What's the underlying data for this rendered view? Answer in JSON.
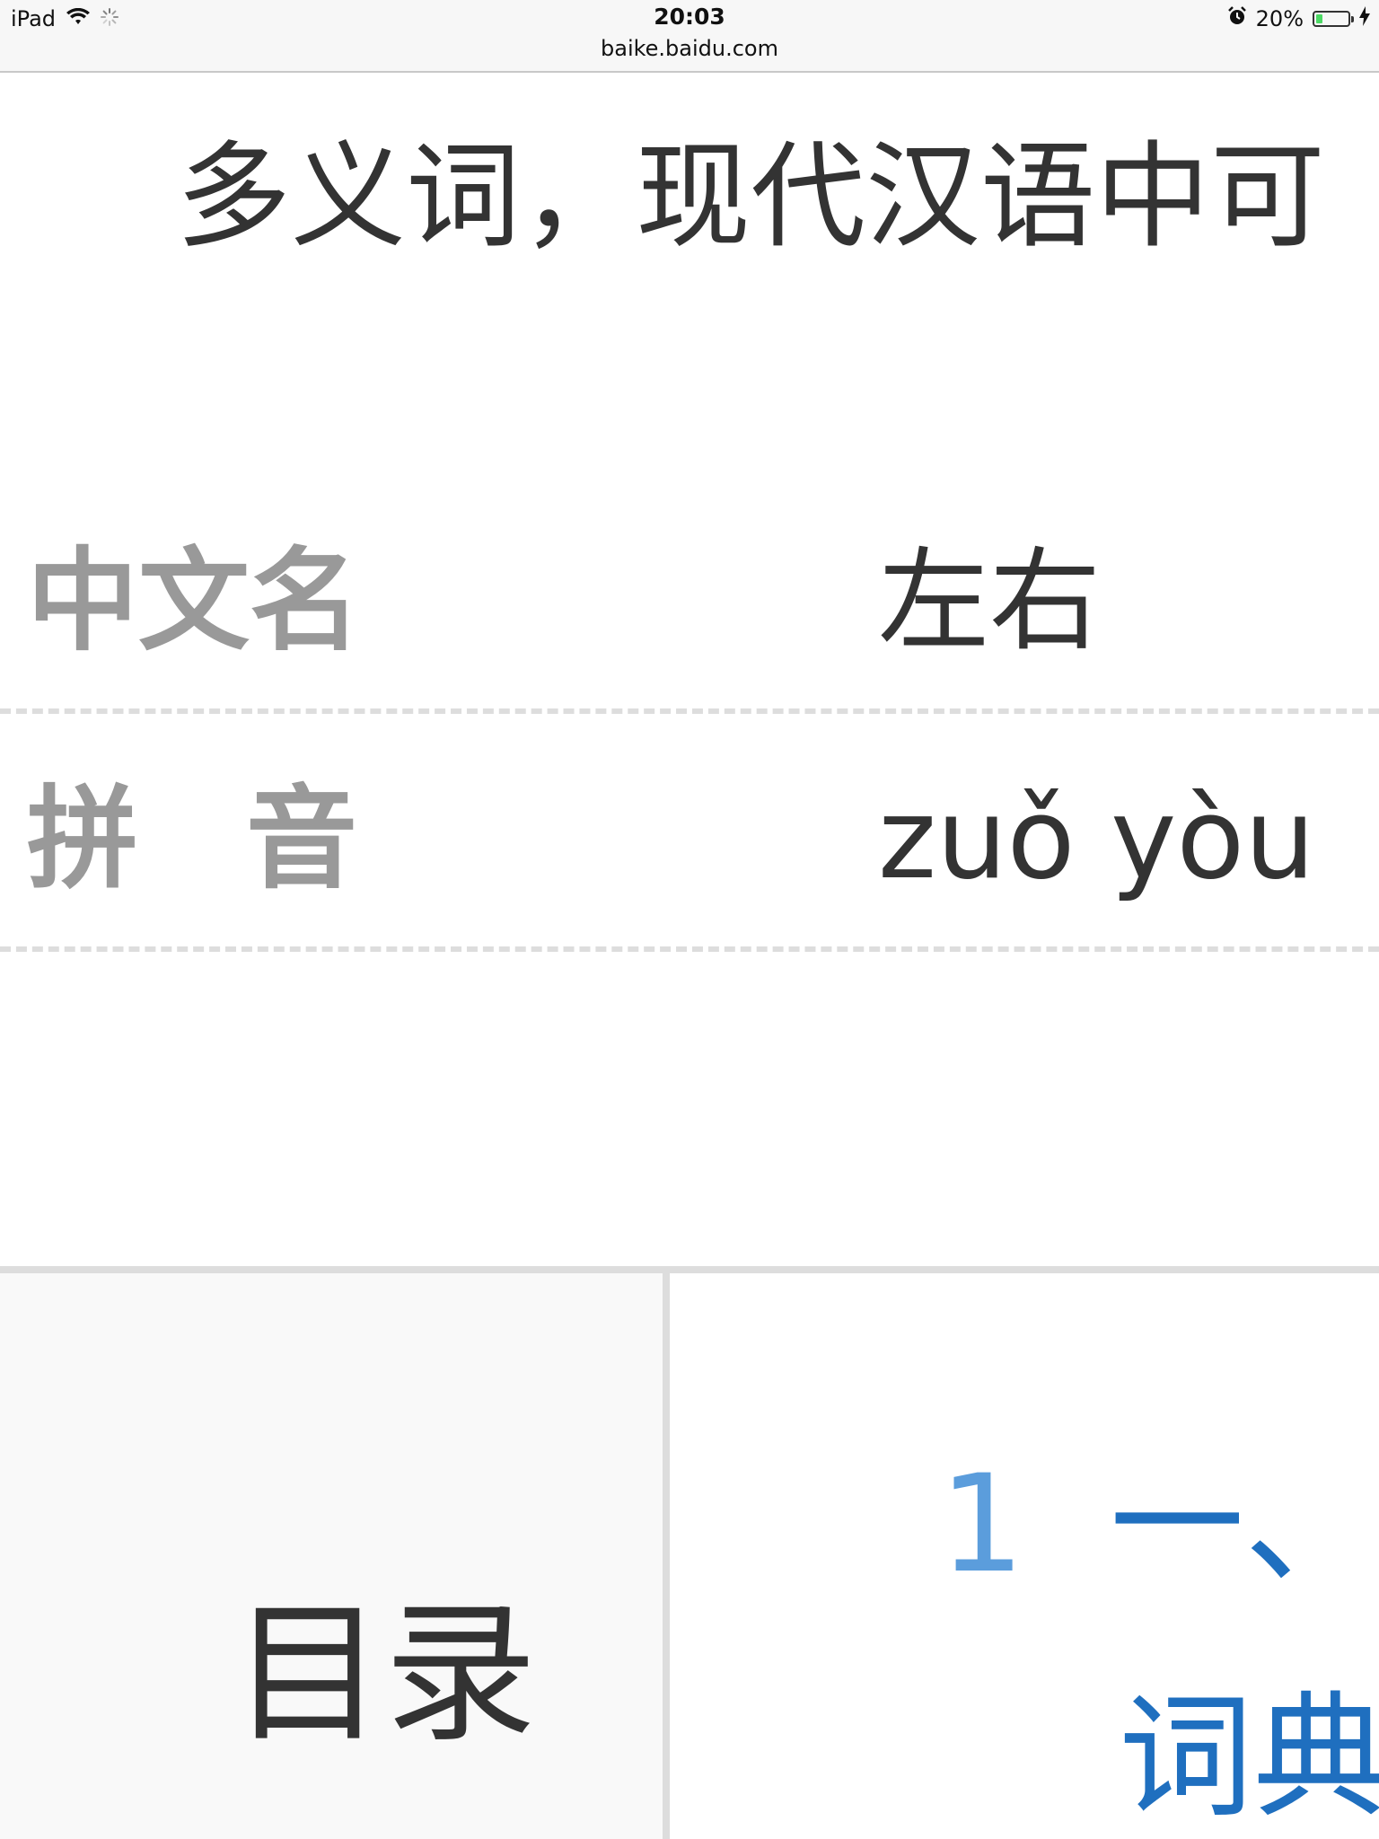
{
  "status_bar": {
    "device": "iPad",
    "time": "20:03",
    "battery_text": "20%",
    "battery_level": 0.2,
    "url": "baike.baidu.com"
  },
  "article": {
    "summary": "多义词，现代汉语中可"
  },
  "info": {
    "name_label": "中文名",
    "name_value": "左右",
    "pinyin_label": "拼音",
    "pinyin_value": "zuǒ yòu"
  },
  "toc": {
    "title": "目录",
    "item_number": "1",
    "item_title": "一、",
    "item_subtitle": "词典"
  },
  "colors": {
    "label_gray": "#999999",
    "text_dark": "#333333",
    "link_blue": "#1f6fbf",
    "number_blue": "#5b9ddc",
    "battery_green": "#4cd964"
  }
}
